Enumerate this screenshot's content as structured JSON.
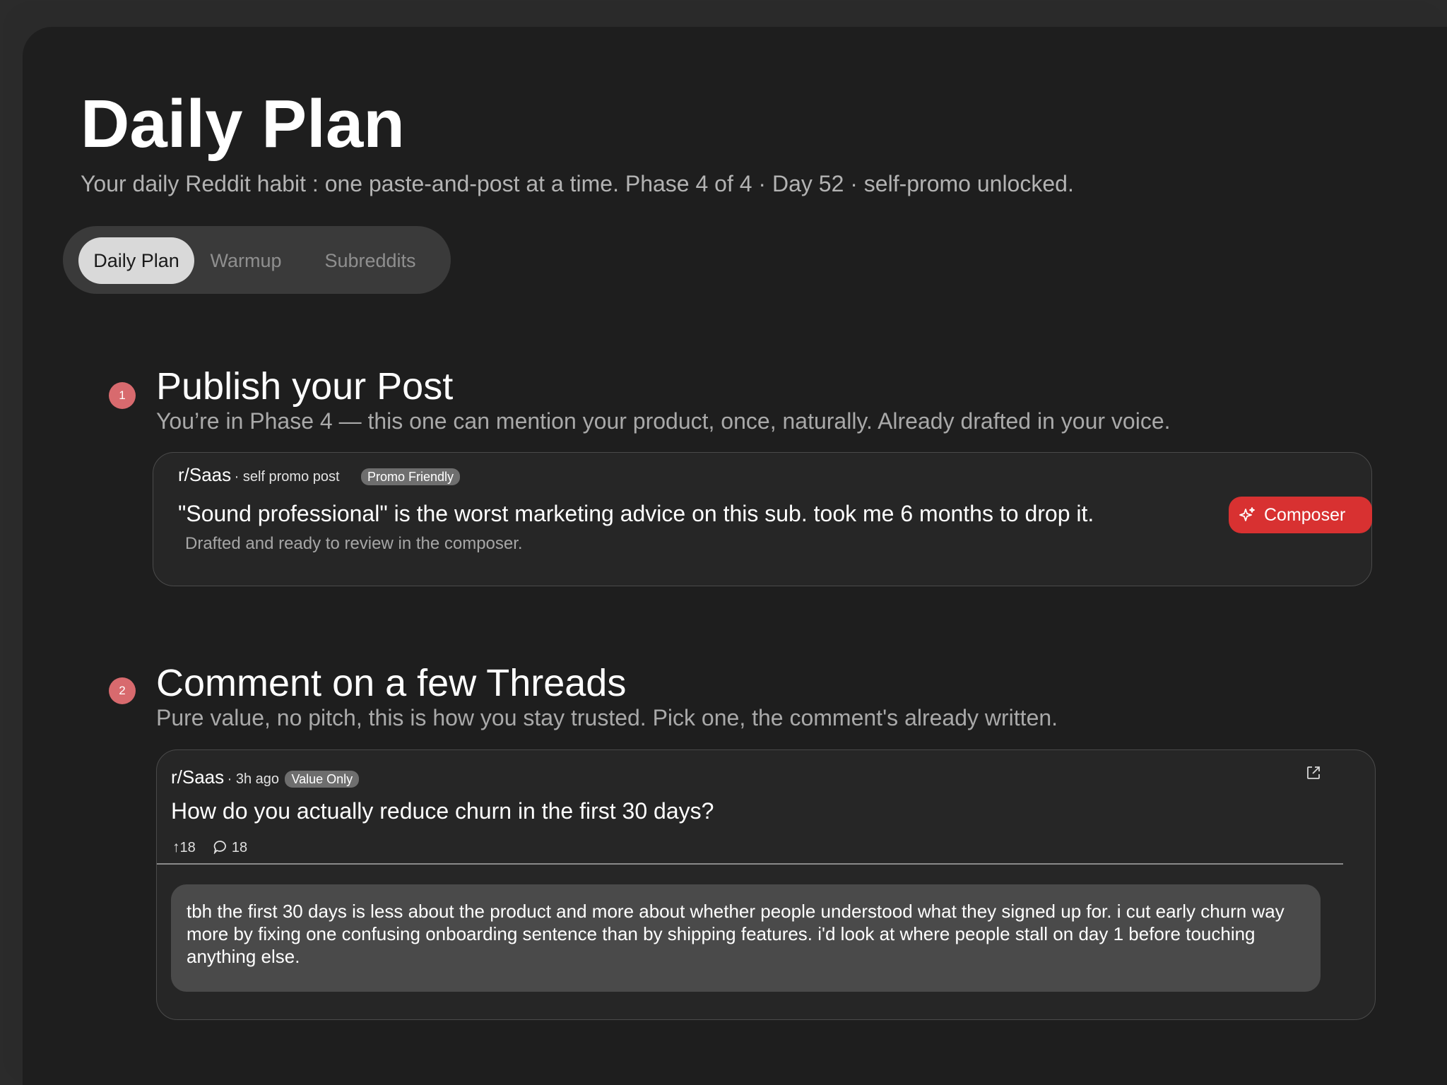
{
  "header": {
    "title": "Daily Plan",
    "subtitle": "Your daily Reddit habit : one paste-and-post at a time. Phase 4 of 4 · Day 52 · self-promo unlocked."
  },
  "tabs": [
    {
      "label": "Daily Plan",
      "active": true
    },
    {
      "label": "Warmup",
      "active": false
    },
    {
      "label": "Subreddits",
      "active": false
    }
  ],
  "steps": [
    {
      "number": "1",
      "title": "Publish your Post",
      "subtitle": "You’re in Phase 4 — this one can mention your product, once, naturally. Already drafted in your voice.",
      "card": {
        "subreddit": "r/Saas",
        "meta": "· self promo post",
        "tag": "Promo Friendly",
        "post_title": "\"Sound professional\" is the worst marketing advice on this sub. took me 6 months to drop it.",
        "note": "Drafted and ready to review in the composer.",
        "button_label": "Composer",
        "button_icon": "sparkle-icon"
      }
    },
    {
      "number": "2",
      "title": "Comment on a few Threads",
      "subtitle": "Pure value, no pitch, this is how you stay trusted. Pick one, the comment's already written.",
      "card": {
        "subreddit": "r/Saas",
        "meta": "· 3h ago",
        "tag": "Value Only",
        "thread_title": "How do you actually reduce churn in the first 30 days?",
        "upvotes": "18",
        "comments": "18",
        "comment_text": "tbh the first 30 days is less about the product and more about whether people understood what they signed up for. i cut early churn way more by fixing one confusing onboarding sentence than by shipping features. i'd look at where people stall on day 1 before touching anything else.",
        "open_icon": "external-link-icon"
      }
    }
  ],
  "colors": {
    "background": "#1e1e1e",
    "accent_red": "#d83131",
    "step_badge": "#d86a6e",
    "tag_bg": "#6e6e6e"
  }
}
